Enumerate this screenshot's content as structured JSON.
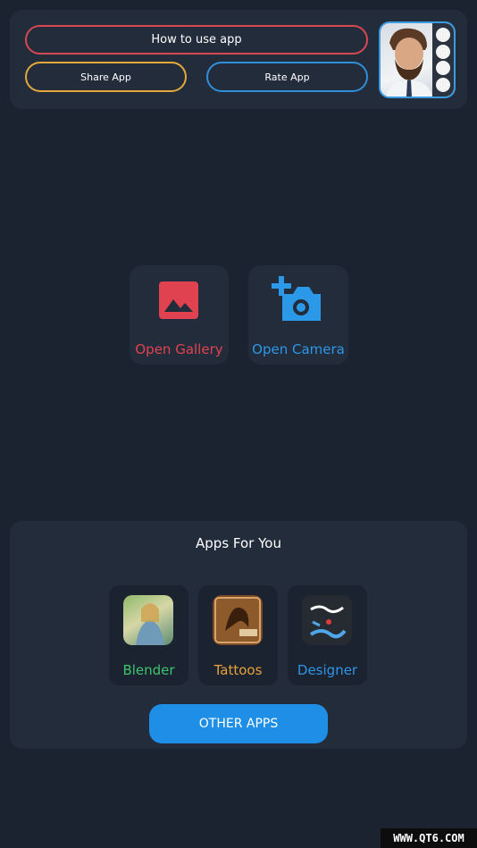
{
  "header": {
    "how_to_label": "How to use app",
    "share_label": "Share App",
    "rate_label": "Rate App"
  },
  "main": {
    "gallery_label": "Open Gallery",
    "camera_label": "Open Camera"
  },
  "apps_section": {
    "title": "Apps For You",
    "apps": [
      {
        "label": "Blender",
        "color": "#3ec46d",
        "icon": "blender-app-icon"
      },
      {
        "label": "Tattoos",
        "color": "#e9a13a",
        "icon": "tattoos-app-icon"
      },
      {
        "label": "Designer",
        "color": "#2f96e6",
        "icon": "designer-app-icon"
      }
    ],
    "other_apps_label": "OTHER APPS"
  },
  "colors": {
    "background": "#1c2330",
    "card": "#232c3b",
    "red": "#e0434f",
    "blue": "#2b98e8",
    "orange": "#e4a83c",
    "button": "#1f8ee6"
  },
  "watermark": "WWW.QT6.COM"
}
